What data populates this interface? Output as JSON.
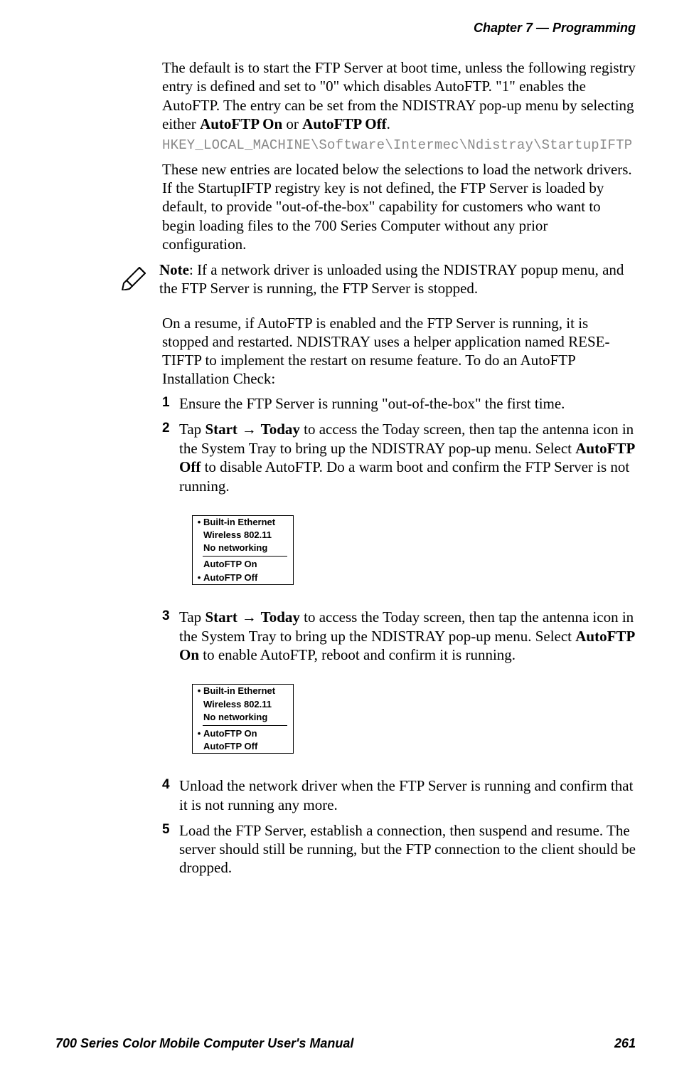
{
  "header": "Chapter 7 — Programming",
  "footer_left": "700 Series Color Mobile Computer User's Manual",
  "footer_right": "261",
  "p1_a": "The default is to start the FTP Server at boot time, unless the following registry entry is defined and set to \"0\" which disables AutoFTP. \"1\" enables the AutoFTP. The entry can be set from the NDISTRAY pop-up menu by selecting either ",
  "p1_b": "AutoFTP On",
  "p1_c": " or ",
  "p1_d": "AutoFTP Off",
  "p1_e": ".",
  "code": "HKEY_LOCAL_MACHINE\\Software\\Intermec\\Ndistray\\StartupIFTP",
  "p2": "These new entries are located below the selections to load the network drivers. If the StartupIFTP registry key is not defined, the FTP Server is loaded by default, to provide \"out-of-the-box\" capability for customers who want to begin loading files to the 700 Series Computer without any prior configuration.",
  "note_label": "Note",
  "note_text": ": If a network driver is unloaded using the NDISTRAY popup menu, and the FTP Server is running, the FTP Server is stopped.",
  "p3": "On a resume, if AutoFTP is enabled and the FTP Server is running, it is stopped and restarted. NDISTRAY uses a helper application named RESE-TIFTP to implement the restart on resume feature. To do an AutoFTP Installation Check:",
  "steps": {
    "s1": "Ensure the FTP Server is running \"out-of-the-box\" the first time.",
    "s2_a": "Tap ",
    "s2_b": "Start",
    "s2_c": " → ",
    "s2_d": "Today",
    "s2_e": " to access the Today screen, then tap the antenna icon in the System Tray to bring up the NDISTRAY pop-up menu. Select ",
    "s2_f": "AutoFTP Off",
    "s2_g": " to disable AutoFTP. Do a warm boot and confirm the FTP Server is not running.",
    "s3_a": "Tap ",
    "s3_b": "Start",
    "s3_c": " → ",
    "s3_d": "Today",
    "s3_e": " to access the Today screen, then tap the antenna icon in the System Tray to bring up the NDISTRAY pop-up menu. Select ",
    "s3_f": "AutoFTP On",
    "s3_g": " to enable AutoFTP, reboot and confirm it is running.",
    "s4": "Unload the network driver when the FTP Server is running and confirm that it is not running any more.",
    "s5": "Load the FTP Server, establish a connection, then suspend and resume. The server should still be running, but the FTP connection to the client should be dropped."
  },
  "nums": {
    "n1": "1",
    "n2": "2",
    "n3": "3",
    "n4": "4",
    "n5": "5"
  },
  "menu": {
    "r1": "Built-in Ethernet",
    "r2": "Wireless 802.11",
    "r3": "No networking",
    "r4": "AutoFTP On",
    "r5": "AutoFTP Off"
  }
}
